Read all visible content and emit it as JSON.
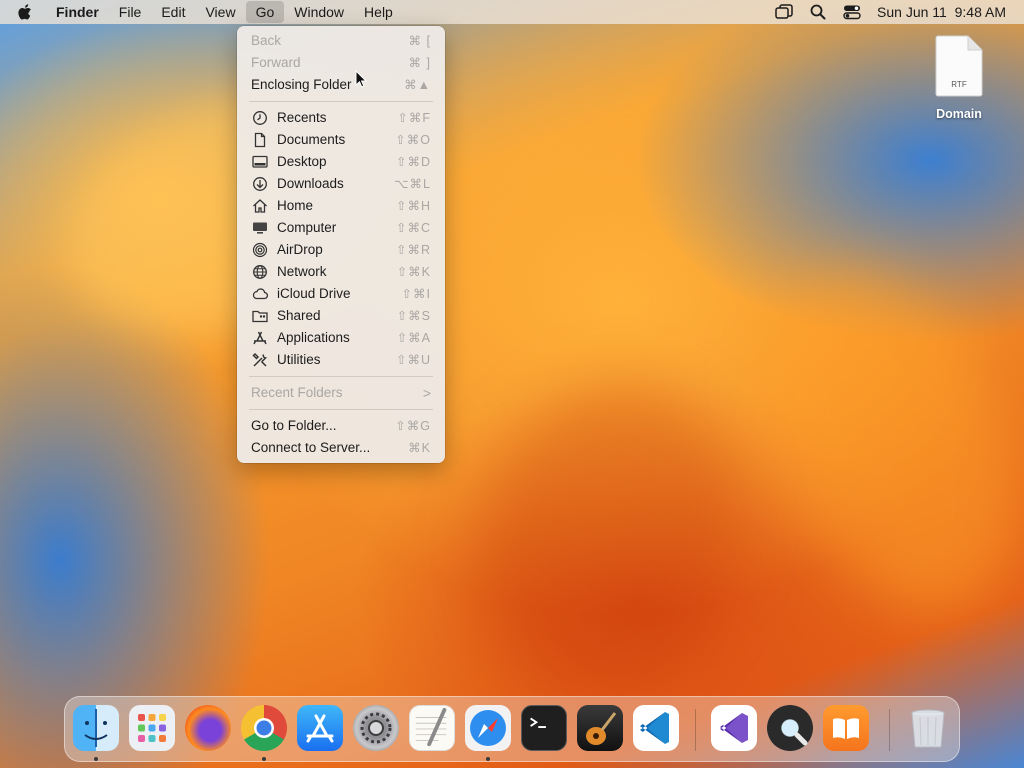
{
  "menubar": {
    "apple_icon": "apple-logo-icon",
    "app_name": "Finder",
    "menus": [
      "File",
      "Edit",
      "View",
      "Go",
      "Window",
      "Help"
    ],
    "active_menu": "Go",
    "status_icons": [
      "screen-mirroring-icon",
      "spotlight-search-icon",
      "control-center-icon"
    ],
    "datetime": "Sun Jun 11  9:48 AM"
  },
  "go_menu": {
    "items": [
      {
        "label": "Back",
        "shortcut": "⌘ [",
        "disabled": true
      },
      {
        "label": "Forward",
        "shortcut": "⌘ ]",
        "disabled": true
      },
      {
        "label": "Enclosing Folder",
        "shortcut": "⌘▲",
        "disabled": false
      },
      {
        "label": "Recents",
        "shortcut": "⇧⌘F",
        "icon": "clock-icon"
      },
      {
        "label": "Documents",
        "shortcut": "⇧⌘O",
        "icon": "document-icon"
      },
      {
        "label": "Desktop",
        "shortcut": "⇧⌘D",
        "icon": "desktop-icon"
      },
      {
        "label": "Downloads",
        "shortcut": "⌥⌘L",
        "icon": "download-icon"
      },
      {
        "label": "Home",
        "shortcut": "⇧⌘H",
        "icon": "home-icon"
      },
      {
        "label": "Computer",
        "shortcut": "⇧⌘C",
        "icon": "computer-icon"
      },
      {
        "label": "AirDrop",
        "shortcut": "⇧⌘R",
        "icon": "airdrop-icon"
      },
      {
        "label": "Network",
        "shortcut": "⇧⌘K",
        "icon": "network-globe-icon"
      },
      {
        "label": "iCloud Drive",
        "shortcut": "⇧⌘I",
        "icon": "cloud-icon"
      },
      {
        "label": "Shared",
        "shortcut": "⇧⌘S",
        "icon": "shared-folder-icon"
      },
      {
        "label": "Applications",
        "shortcut": "⇧⌘A",
        "icon": "applications-icon"
      },
      {
        "label": "Utilities",
        "shortcut": "⇧⌘U",
        "icon": "utilities-tools-icon"
      },
      {
        "label": "Recent Folders",
        "disabled": true,
        "submenu": true
      },
      {
        "label": "Go to Folder...",
        "shortcut": "⇧⌘G"
      },
      {
        "label": "Connect to Server...",
        "shortcut": "⌘K"
      }
    ],
    "submenu_chevron": ">"
  },
  "desktop": {
    "file_label": "Domain",
    "file_type": "RTF"
  },
  "dock": {
    "apps": [
      {
        "name": "finder-icon",
        "running": true
      },
      {
        "name": "launchpad-icon",
        "running": false
      },
      {
        "name": "firefox-icon",
        "running": false
      },
      {
        "name": "chrome-icon",
        "running": true
      },
      {
        "name": "app-store-icon",
        "running": false
      },
      {
        "name": "system-settings-icon",
        "running": false
      },
      {
        "name": "textedit-icon",
        "running": false
      },
      {
        "name": "safari-icon",
        "running": true
      },
      {
        "name": "terminal-icon",
        "running": false
      },
      {
        "name": "garageband-icon",
        "running": false
      },
      {
        "name": "vscode-icon",
        "running": false
      },
      {
        "name": "visual-studio-icon",
        "running": false
      },
      {
        "name": "quicktime-icon",
        "running": false
      },
      {
        "name": "books-icon",
        "running": false
      },
      {
        "name": "trash-icon",
        "running": false
      }
    ]
  }
}
